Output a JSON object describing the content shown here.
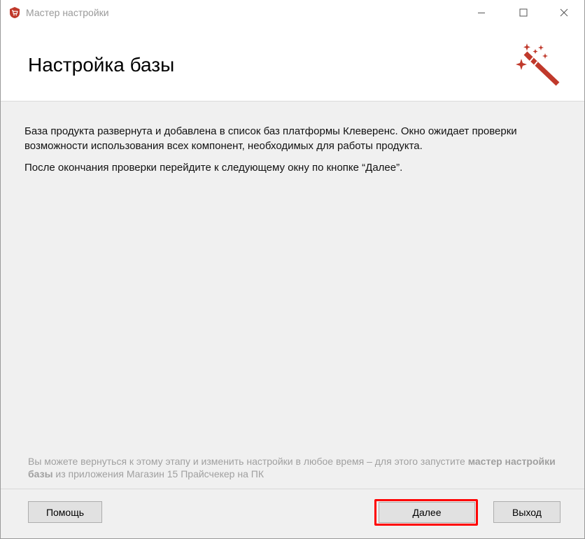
{
  "window": {
    "title": "Мастер настройки"
  },
  "header": {
    "title": "Настройка базы"
  },
  "content": {
    "paragraph1": "База продукта развернута и добавлена в список баз платформы Клеверенс. Окно ожидает проверки возможности использования всех компонент, необходимых для работы продукта.",
    "paragraph2": "После окончания проверки перейдите к следующему окну по кнопке “Далее”.",
    "hint_prefix": "Вы можете вернуться к этому этапу и изменить настройки в любое время – для этого запустите ",
    "hint_bold": "мастер настройки базы",
    "hint_suffix": " из приложения Магазин 15 Прайсчекер на ПК"
  },
  "footer": {
    "help_label": "Помощь",
    "next_label": "Далее",
    "exit_label": "Выход"
  },
  "colors": {
    "accent_red": "#c0392b",
    "highlight": "#ff0000"
  },
  "icons": {
    "app": "app-shield-cart-icon",
    "header": "magic-wand-icon"
  }
}
